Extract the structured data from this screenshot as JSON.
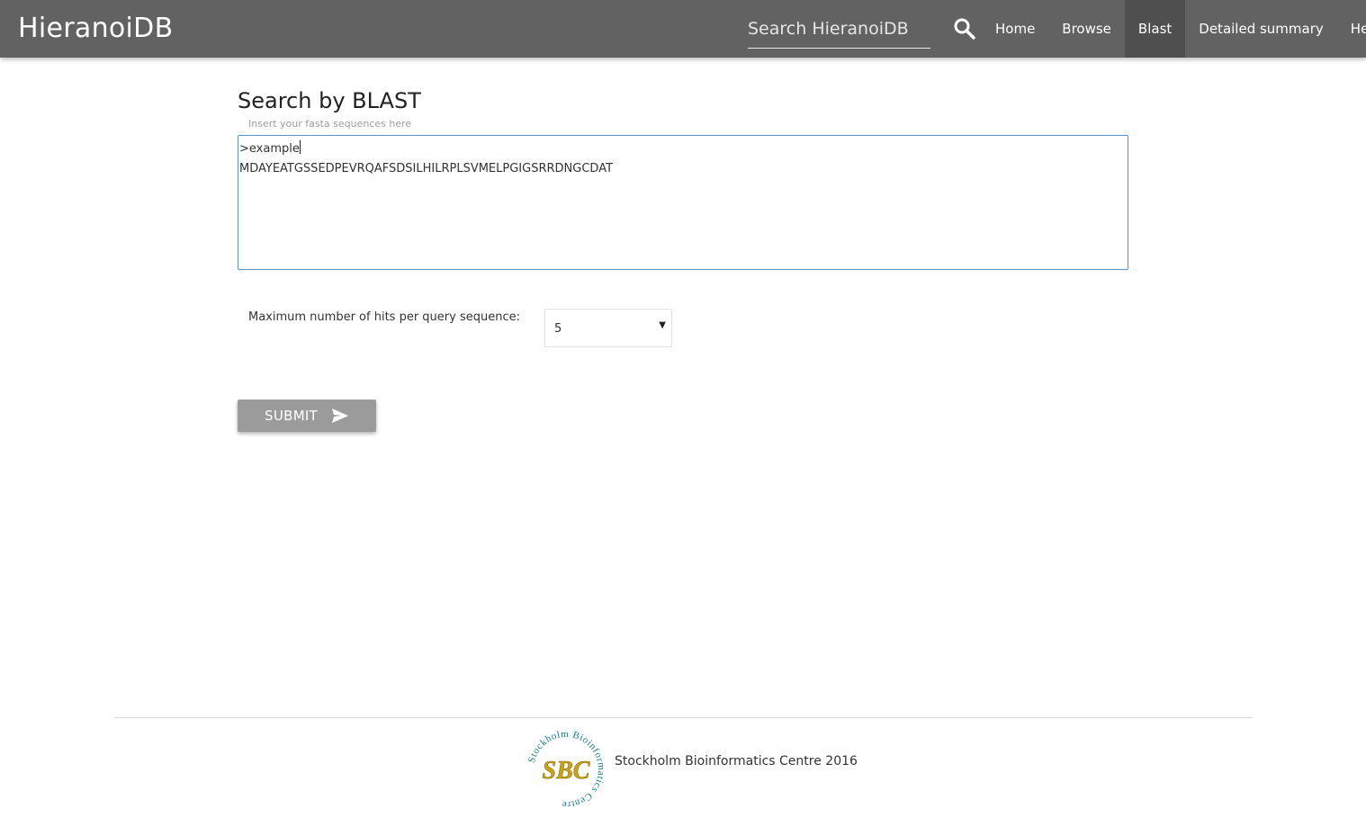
{
  "app": {
    "title": "HieranoiDB"
  },
  "header": {
    "search_placeholder": "Search HieranoiDB",
    "search_icon": "search-icon",
    "nav": [
      {
        "label": "Home",
        "active": false
      },
      {
        "label": "Browse",
        "active": false
      },
      {
        "label": "Blast",
        "active": true
      },
      {
        "label": "Detailed summary",
        "active": false
      },
      {
        "label": "Help",
        "active": false
      }
    ]
  },
  "main": {
    "title": "Search by BLAST",
    "sequence_hint": "Insert your fasta sequences here",
    "sequence_lines": [
      ">example",
      "MDAYEATGSSEDPEVRQAFSDSILHILRPLSVMELPGIGSRRDNGCDAT"
    ],
    "max_hits_label": "Maximum number of hits per query sequence:",
    "max_hits_value": "5",
    "submit_label": "SUBMIT",
    "submit_icon": "send-icon"
  },
  "footer": {
    "logo_text": "SBC",
    "logo_ring_text": "Stockholm Bioinformatics Centre",
    "text": "Stockholm Bioinformatics Centre 2016"
  },
  "colors": {
    "navbar": "#626262",
    "nav_active": "#4f4f4f",
    "textarea_border": "#5b95c8",
    "submit": "#9b9b9b",
    "logo_ring": "#1c7a86",
    "logo_gold": "#c9a418"
  }
}
